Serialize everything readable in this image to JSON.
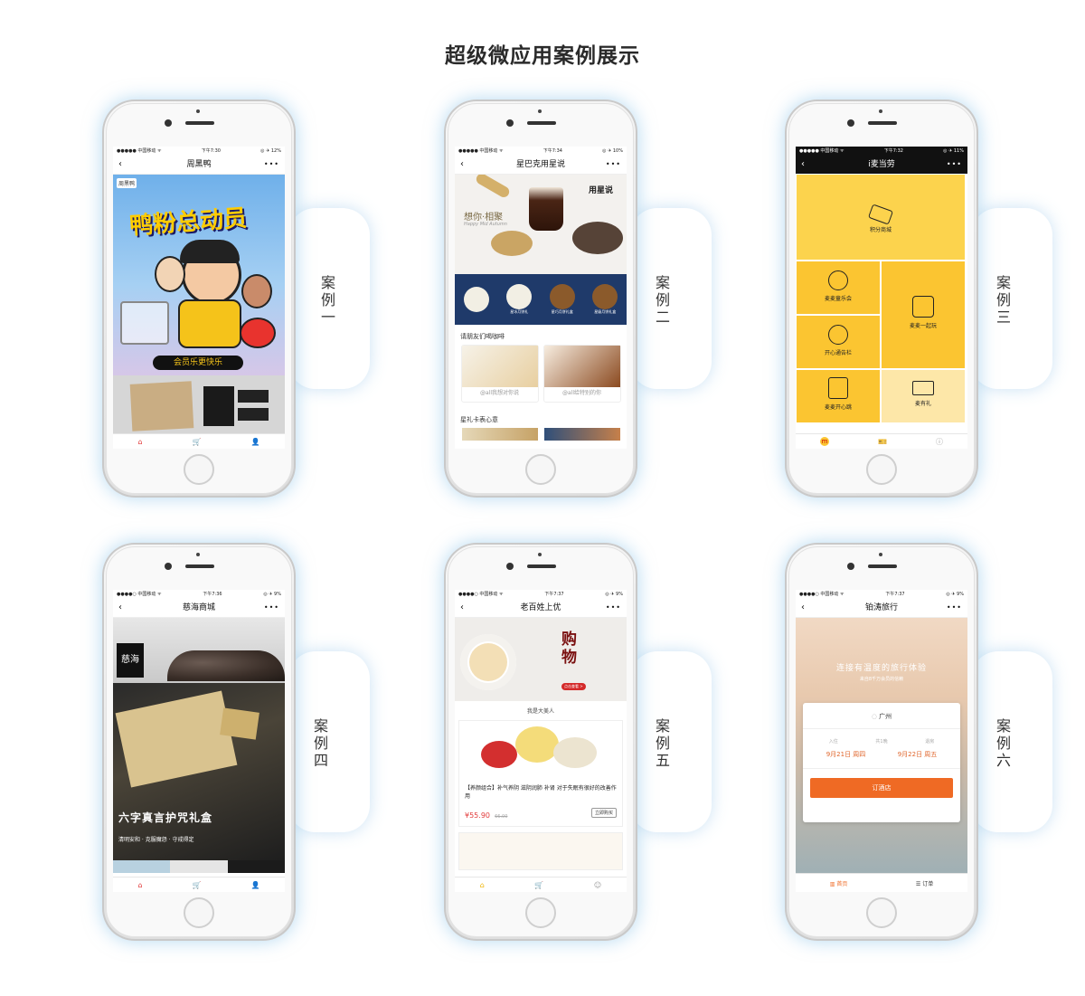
{
  "page": {
    "title": "超级微应用案例展示"
  },
  "cases": [
    {
      "label": "案例一",
      "chars": [
        "案",
        "例",
        "一"
      ],
      "status": {
        "carrier": "●●●●● 中国移动 ᯤ",
        "time": "下午7:30",
        "battery": "◎ ✈ 12%"
      },
      "nav_title": "周黑鸭",
      "back": "‹",
      "more": "•••",
      "logo": "周黑鸭",
      "banner_text": "鸭粉总动员",
      "ribbon": "会员乐更快乐",
      "icons": {
        "home": "⌂",
        "cart": "🛒",
        "user": "👤"
      }
    },
    {
      "label": "案例二",
      "chars": [
        "案",
        "例",
        "二"
      ],
      "status": {
        "carrier": "●●●●● 中国移动 ᯤ",
        "time": "下午7:34",
        "battery": "◎ ✈ 10%"
      },
      "nav_title": "星巴克用星说",
      "back": "‹",
      "more": "•••",
      "hero_left": "想你·相聚",
      "hero_left_sub": "Happy Mid Autumn",
      "hero_right": "用星说",
      "strip": [
        "",
        "星冰月饼礼",
        "星巧月饼礼盒",
        "星级月饼礼盒"
      ],
      "section1": "请朋友们喝咖啡",
      "card1": "@all我想对你说",
      "card2": "@all给特别的你",
      "section2": "星礼卡表心意"
    },
    {
      "label": "案例三",
      "chars": [
        "案",
        "例",
        "三"
      ],
      "status": {
        "carrier": "●●●●● 中国移动 ᯤ",
        "time": "下午7:32",
        "battery": "◎ ✈ 11%"
      },
      "nav_title": "i麦当劳",
      "back": "‹",
      "more": "•••",
      "tiles": {
        "points": "积分商城",
        "kids": "麦麦童乐会",
        "play": "麦麦一起玩",
        "happy": "开心通告栏",
        "jump": "麦麦开心跳",
        "gift": "麦有礼"
      },
      "icons": {
        "home": "m",
        "ticket": "🎫",
        "info": "ⓘ"
      }
    },
    {
      "label": "案例四",
      "chars": [
        "案",
        "例",
        "四"
      ],
      "status": {
        "carrier": "●●●●○ 中国移动 ᯤ",
        "time": "下午7:36",
        "battery": "◎ ✈ 9%"
      },
      "nav_title": "慈海商城",
      "back": "‹",
      "more": "•••",
      "logo": "慈海",
      "banner_title": "六字真言护咒礼盒",
      "banner_sub": "清明安和 · 克服魔怨 · 守戒得定",
      "icons": {
        "home": "⌂",
        "cart": "🛒",
        "user": "👤"
      }
    },
    {
      "label": "案例五",
      "chars": [
        "案",
        "例",
        "五"
      ],
      "status": {
        "carrier": "●●●●○ 中国移动 ᯤ",
        "time": "下午7:37",
        "battery": "◎ ✈ 9%"
      },
      "nav_title": "老百姓上优",
      "back": "‹",
      "more": "•••",
      "banner_text": "购物",
      "banner_btn": "点击查看 >",
      "section": "我是大美人",
      "product_desc": "【养颜组合】补气养阴 滋阴润肺 补肾 对于失眠有很好的改善作用",
      "price": "¥55.90",
      "old_price": "66.00",
      "buy": "立即购买",
      "icons": {
        "home": "⌂",
        "cart": "🛒",
        "user": "☺"
      }
    },
    {
      "label": "案例六",
      "chars": [
        "案",
        "例",
        "六"
      ],
      "status": {
        "carrier": "●●●●○ 中国移动 ᯤ",
        "time": "下午7:37",
        "battery": "◎ ✈ 9%"
      },
      "nav_title": "铂涛旅行",
      "back": "‹",
      "more": "•••",
      "headline": "连接有温度的旅行体验",
      "subline": "来自8千万会员的信赖",
      "city": "广州",
      "checkin_label": "入住",
      "nights_label": "共1晚",
      "checkout_label": "退房",
      "checkin": "9月21日 周四",
      "checkout": "9月22日 周五",
      "book": "订酒店",
      "tab_home": "首页",
      "tab_orders": "订单"
    }
  ],
  "colors": {
    "mcd_yellow": "#fbc531",
    "mcd_light": "#fcd34d",
    "starbucks_navy": "#1f3a6a",
    "accent_red": "#e23b3b",
    "orange": "#ef6a24"
  }
}
